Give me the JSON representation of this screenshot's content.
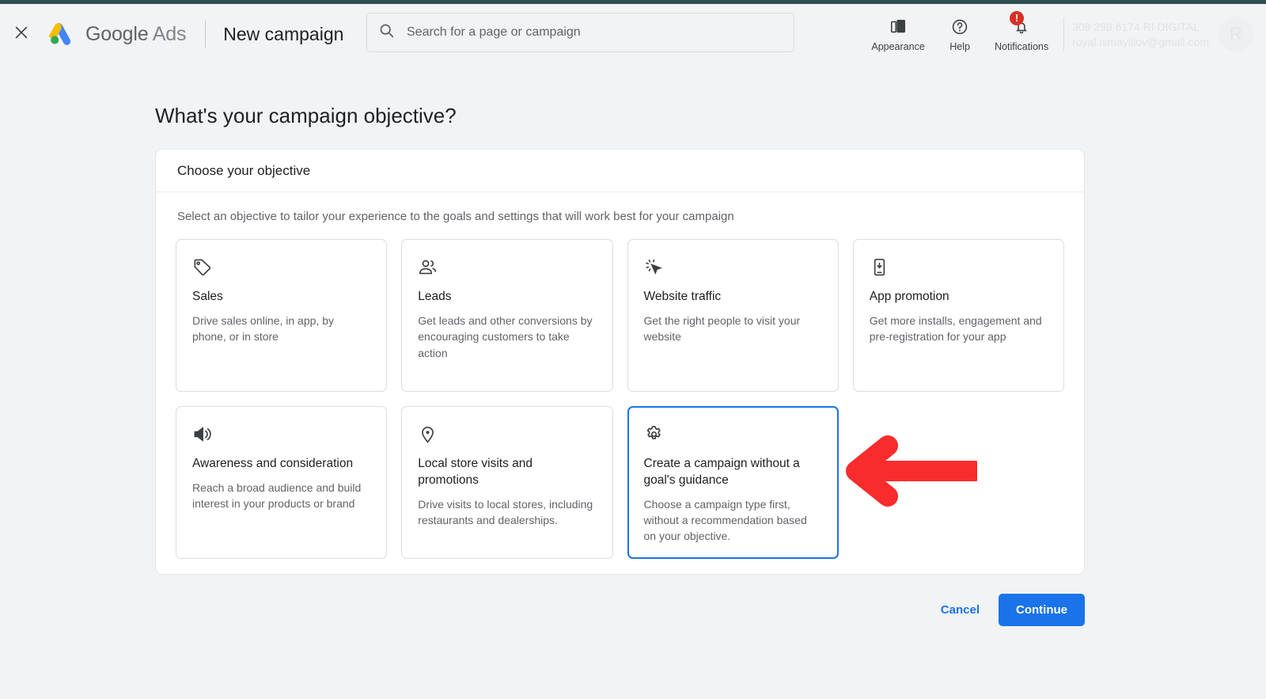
{
  "header": {
    "close_icon": "close-icon",
    "brand_google": "Google",
    "brand_ads": "Ads",
    "page_title": "New campaign",
    "search": {
      "icon": "search-icon",
      "placeholder": "Search for a page or campaign",
      "value": ""
    },
    "actions": [
      {
        "label": "Appearance",
        "icon": "appearance-icon"
      },
      {
        "label": "Help",
        "icon": "help-icon"
      },
      {
        "label": "Notifications",
        "icon": "bell-icon",
        "badge": "!"
      }
    ],
    "account": {
      "line1": "309 298 6174 RI DIGITAL",
      "line2": "royal.ismayillov@gmail.com",
      "avatar_initial": "R"
    }
  },
  "main": {
    "heading": "What's your campaign objective?",
    "card_title": "Choose your objective",
    "card_subtitle": "Select an objective to tailor your experience to the goals and settings that will work best for your campaign",
    "objectives": [
      {
        "icon": "tag-icon",
        "title": "Sales",
        "description": "Drive sales online, in app, by phone, or in store",
        "selected": false
      },
      {
        "icon": "people-icon",
        "title": "Leads",
        "description": "Get leads and other conversions by encouraging customers to take action",
        "selected": false
      },
      {
        "icon": "cursor-click-icon",
        "title": "Website traffic",
        "description": "Get the right people to visit your website",
        "selected": false
      },
      {
        "icon": "mobile-download-icon",
        "title": "App promotion",
        "description": "Get more installs, engagement and pre-registration for your app",
        "selected": false
      },
      {
        "icon": "megaphone-icon",
        "title": "Awareness and consideration",
        "description": "Reach a broad audience and build interest in your products or brand",
        "selected": false
      },
      {
        "icon": "location-pin-icon",
        "title": "Local store visits and promotions",
        "description": "Drive visits to local stores, including restaurants and dealerships.",
        "selected": false
      },
      {
        "icon": "gear-icon",
        "title": "Create a campaign without a goal's guidance",
        "description": "Choose a campaign type first, without a recommendation based on your objective.",
        "selected": true
      }
    ]
  },
  "footer": {
    "cancel_label": "Cancel",
    "continue_label": "Continue"
  },
  "annotation": {
    "type": "arrow-left",
    "color": "#f82c2c",
    "points_to": "Create a campaign without a goal's guidance"
  },
  "colors": {
    "accent": "#1a73e8",
    "page_background": "#f1f3f4",
    "card_background": "#ffffff",
    "badge_red": "#d93025",
    "annotation_red": "#f82c2c",
    "top_strip": "#2e4f51"
  }
}
